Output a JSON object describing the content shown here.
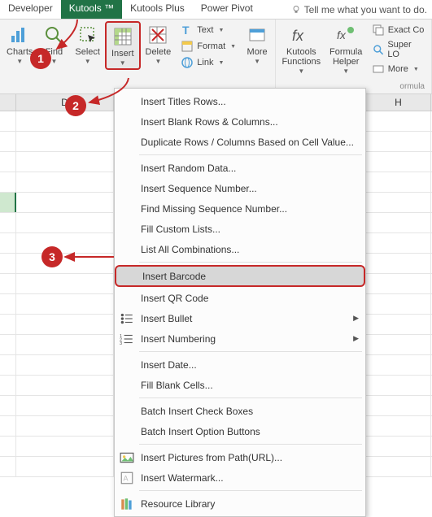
{
  "tabs": {
    "developer": "Developer",
    "kutools": "Kutools ™",
    "kutools_plus": "Kutools Plus",
    "power_pivot": "Power Pivot",
    "tell_me": "Tell me what you want to do."
  },
  "ribbon": {
    "charts": "Charts",
    "find": "Find",
    "select": "Select",
    "insert": "Insert",
    "delete": "Delete",
    "text": "Text",
    "format": "Format",
    "link": "Link",
    "more": "More",
    "kutools_functions": "Kutools\nFunctions",
    "formula_helper": "Formula\nHelper",
    "exact_copy": "Exact Co",
    "super_lookup": "Super LO",
    "more2": "More",
    "group_formula": "ormula"
  },
  "cols": {
    "d": "D",
    "h": "H"
  },
  "menu": {
    "i1": "Insert Titles Rows...",
    "i2": "Insert Blank Rows & Columns...",
    "i3": "Duplicate Rows / Columns Based on Cell Value...",
    "i4": "Insert Random Data...",
    "i5": "Insert Sequence Number...",
    "i6": "Find Missing Sequence Number...",
    "i7": "Fill Custom Lists...",
    "i8": "List All Combinations...",
    "i9": "Insert Barcode",
    "i10": "Insert QR Code",
    "i11": "Insert Bullet",
    "i12": "Insert Numbering",
    "i13": "Insert Date...",
    "i14": "Fill Blank Cells...",
    "i15": "Batch Insert Check Boxes",
    "i16": "Batch Insert Option Buttons",
    "i17": "Insert Pictures from Path(URL)...",
    "i18": "Insert Watermark...",
    "i19": "Resource Library"
  },
  "callouts": {
    "c1": "1",
    "c2": "2",
    "c3": "3"
  }
}
